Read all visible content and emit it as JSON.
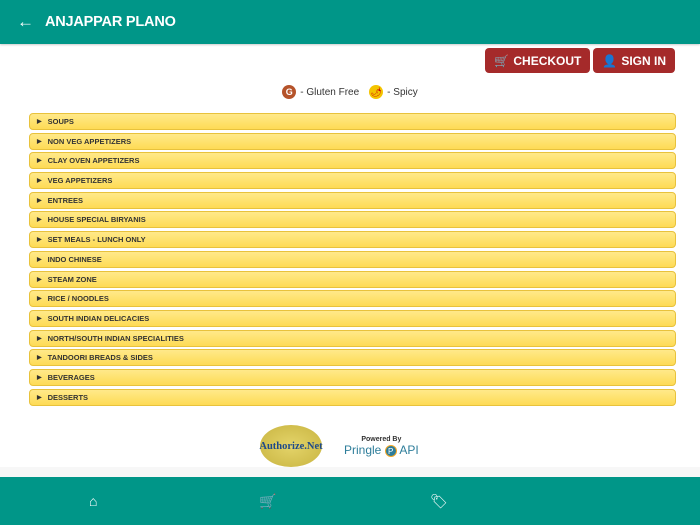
{
  "header": {
    "title": "ANJAPPAR PLANO"
  },
  "actions": {
    "checkout": "CHECKOUT",
    "signin": "SIGN IN"
  },
  "legend": {
    "gluten_free": "- Gluten Free",
    "spicy": "- Spicy",
    "g": "G"
  },
  "categories": [
    "SOUPS",
    "NON VEG APPETIZERS",
    "CLAY OVEN APPETIZERS",
    "VEG APPETIZERS",
    "ENTREES",
    "HOUSE SPECIAL BIRYANIS",
    "SET MEALS - LUNCH ONLY",
    "INDO CHINESE",
    "STEAM ZONE",
    "RICE / NOODLES",
    "SOUTH INDIAN DELICACIES",
    "NORTH/SOUTH INDIAN SPECIALITIES",
    "TANDOORI BREADS & SIDES",
    "BEVERAGES",
    "DESSERTS"
  ],
  "footer": {
    "authorize": "Authorize.Net",
    "powered_by": "Powered By",
    "pringle": "Pringle",
    "api": "API",
    "p": "P"
  },
  "colors": {
    "primary": "#009688",
    "button": "#a52a2a",
    "category": "#fedb55"
  }
}
